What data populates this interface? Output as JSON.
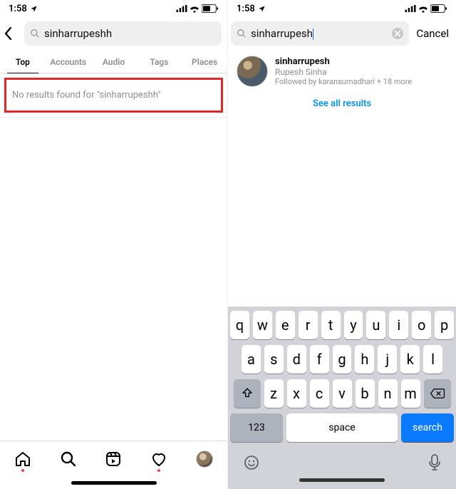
{
  "status": {
    "time": "1:58",
    "signal": "▪▪▪▪",
    "wifi": "wifi",
    "battery": "60"
  },
  "left": {
    "search_query": "sinharrupeshh",
    "tabs": [
      "Top",
      "Accounts",
      "Audio",
      "Tags",
      "Places"
    ],
    "active_tab_index": 0,
    "no_results_prefix": "No results found for ",
    "no_results_term": "\"sinharrupeshh\""
  },
  "right": {
    "search_query": "sinharrupesh",
    "cancel_label": "Cancel",
    "result": {
      "username": "sinharrupesh",
      "fullname": "Rupesh Sinha",
      "followed_by": "Followed by karansumadhari + 18 more"
    },
    "see_all_label": "See all results"
  },
  "keyboard": {
    "row1": [
      "q",
      "w",
      "e",
      "r",
      "t",
      "y",
      "u",
      "i",
      "o",
      "p"
    ],
    "row2": [
      "a",
      "s",
      "d",
      "f",
      "g",
      "h",
      "j",
      "k",
      "l"
    ],
    "row3": [
      "z",
      "x",
      "c",
      "v",
      "b",
      "n",
      "m"
    ],
    "num_label": "123",
    "space_label": "space",
    "action_label": "search"
  }
}
